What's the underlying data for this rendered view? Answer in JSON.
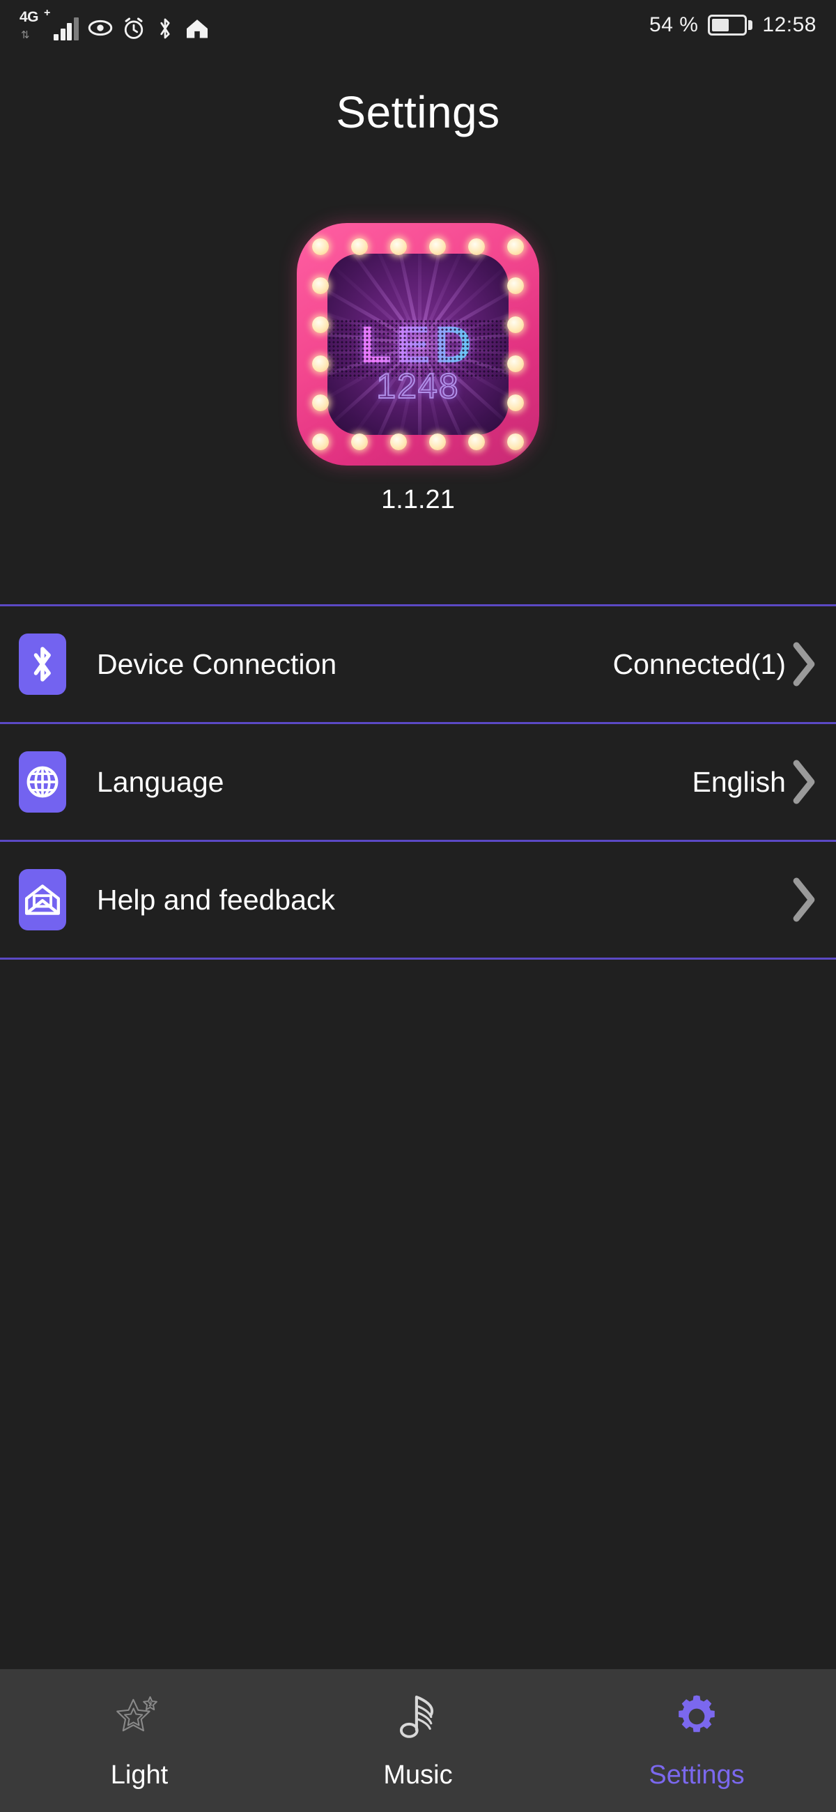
{
  "status_bar": {
    "network_type": "4G",
    "network_plus": "+",
    "data_arrows": "⇅",
    "icons": [
      "eye-icon",
      "alarm-icon",
      "bluetooth-icon",
      "home-icon"
    ],
    "battery_percent": "54 %",
    "battery_level": 54,
    "time": "12:58"
  },
  "header": {
    "title": "Settings"
  },
  "app": {
    "logo_text": "LED",
    "logo_number": "1248",
    "version": "1.1.21",
    "logo_name": "led-1248-app-icon"
  },
  "settings": {
    "rows": [
      {
        "id": "device-connection",
        "icon": "bluetooth-icon",
        "label": "Device Connection",
        "value": "Connected(1)",
        "chevron": "chevron-right-icon"
      },
      {
        "id": "language",
        "icon": "globe-icon",
        "label": "Language",
        "value": "English",
        "chevron": "chevron-right-icon"
      },
      {
        "id": "help-and-feedback",
        "icon": "envelope-icon",
        "label": "Help and feedback",
        "value": "",
        "chevron": "chevron-right-icon"
      }
    ]
  },
  "bottom_nav": {
    "items": [
      {
        "id": "light",
        "label": "Light",
        "icon": "star-outline-icon",
        "active": false
      },
      {
        "id": "music",
        "label": "Music",
        "icon": "music-note-icon",
        "active": false
      },
      {
        "id": "settings",
        "label": "Settings",
        "icon": "gear-icon",
        "active": true
      }
    ]
  },
  "colors": {
    "background": "#202020",
    "nav_background": "#3a3a3a",
    "accent_purple": "#7b68ee",
    "icon_tile": "#7363f0",
    "divider": "#5b49c4",
    "text_primary": "#ffffff",
    "chevron_gray": "#9a9a9a",
    "inactive_icon": "#8a8a8a"
  }
}
